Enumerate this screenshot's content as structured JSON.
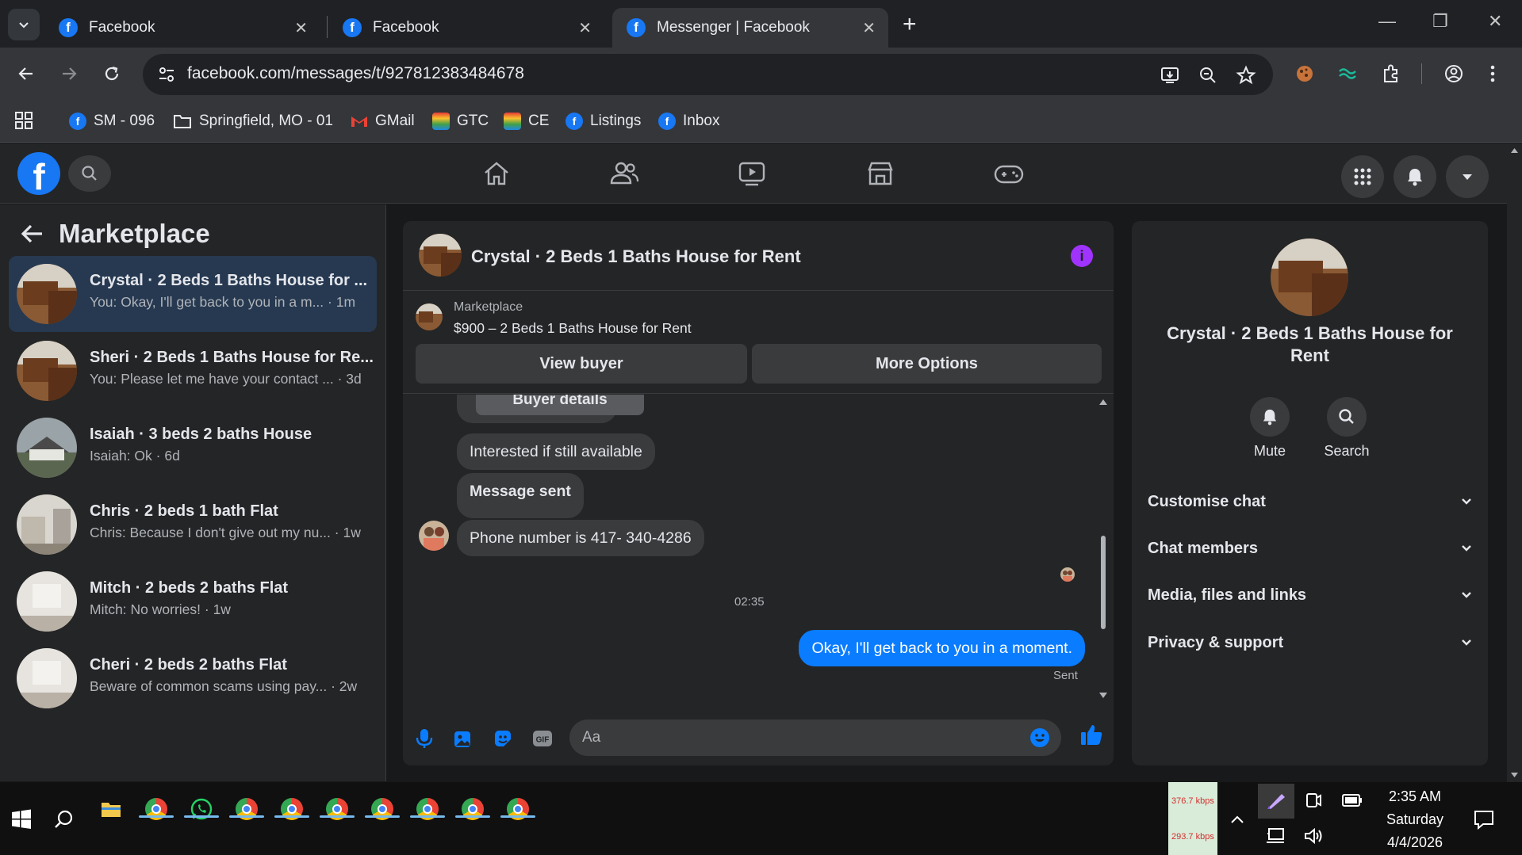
{
  "browser": {
    "tabs": [
      {
        "title": "Facebook",
        "active": false
      },
      {
        "title": "Facebook",
        "active": false
      },
      {
        "title": "Messenger | Facebook",
        "active": true
      }
    ],
    "url": "facebook.com/messages/t/927812383484678",
    "bookmarks": [
      {
        "label": "SM - 096",
        "icon": "facebook-icon"
      },
      {
        "label": "Springfield, MO - 01",
        "icon": "folder-icon"
      },
      {
        "label": "GMail",
        "icon": "gmail-icon"
      },
      {
        "label": "GTC",
        "icon": "rainbow-icon"
      },
      {
        "label": "CE",
        "icon": "rainbow-icon"
      },
      {
        "label": "Listings",
        "icon": "facebook-icon"
      },
      {
        "label": "Inbox",
        "icon": "facebook-icon"
      }
    ]
  },
  "sidebar": {
    "title": "Marketplace",
    "conversations": [
      {
        "name": "Crystal · 2 Beds 1 Baths House for ...",
        "snippet": "You: Okay, I'll get back to you in a m... · 1m",
        "active": true
      },
      {
        "name": "Sheri · 2 Beds 1 Baths House for Re...",
        "snippet": "You: Please let me have your contact ... · 3d",
        "active": false
      },
      {
        "name": "Isaiah · 3 beds 2 baths House",
        "snippet": "Isaiah: Ok · 6d",
        "active": false
      },
      {
        "name": "Chris · 2 beds 1 bath Flat",
        "snippet": "Chris: Because I don't give out my nu... · 1w",
        "active": false
      },
      {
        "name": "Mitch · 2 beds 2 baths Flat",
        "snippet": "Mitch: No worries! · 1w",
        "active": false
      },
      {
        "name": "Cheri · 2 beds 2 baths Flat",
        "snippet": "Beware of common scams using pay... · 2w",
        "active": false
      }
    ]
  },
  "chat": {
    "title": "Crystal · 2 Beds 1 Baths House for Rent",
    "listing_label": "Marketplace",
    "listing_price": "$900 – 2 Beds 1 Baths House for Rent",
    "view_buyer": "View buyer",
    "more_options": "More Options",
    "buyer_details": "Buyer details",
    "messages": [
      {
        "text": "Interested if still available",
        "direction": "in"
      },
      {
        "text": "Message sent",
        "direction": "in"
      },
      {
        "text": "Phone number is 417- 340-4286",
        "direction": "in"
      }
    ],
    "timestamp": "02:35",
    "outgoing": "Okay, I'll get back to you in a moment.",
    "status": "Sent",
    "input_placeholder": "Aa"
  },
  "details": {
    "name": "Crystal · 2 Beds 1 Baths House for Rent",
    "actions": [
      {
        "label": "Mute",
        "icon": "bell-icon"
      },
      {
        "label": "Search",
        "icon": "search-icon"
      }
    ],
    "sections": [
      "Customise chat",
      "Chat members",
      "Media, files and links",
      "Privacy & support"
    ]
  },
  "taskbar": {
    "net_up": "376.7 kbps",
    "net_down": "293.7 kbps",
    "time": "2:35 AM",
    "day": "Saturday",
    "date": "4/4/2026"
  },
  "colors": {
    "accent": "#0a7cff",
    "fb_blue": "#1877f2",
    "active_row": "#263951",
    "info": "#a033ff"
  }
}
